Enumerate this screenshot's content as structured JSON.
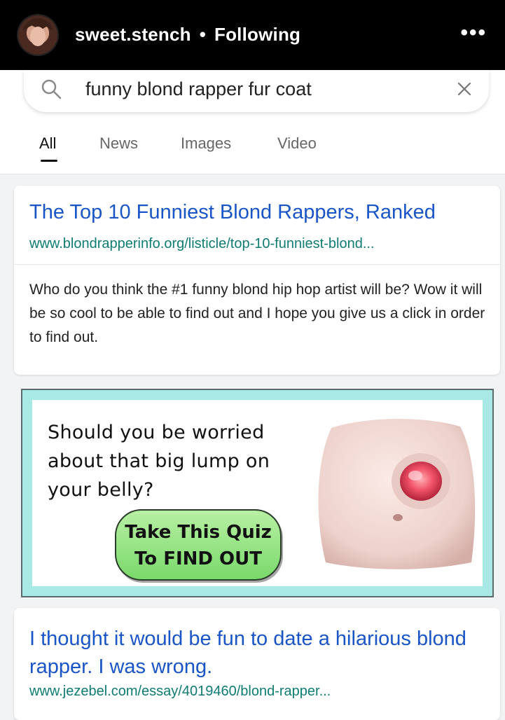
{
  "header": {
    "username": "sweet.stench",
    "separator": "•",
    "follow_status": "Following",
    "more_glyph": "•••"
  },
  "search": {
    "query": "funny blond rapper fur coat"
  },
  "tabs": [
    {
      "label": "All",
      "active": true
    },
    {
      "label": "News",
      "active": false
    },
    {
      "label": "Images",
      "active": false
    },
    {
      "label": "Video",
      "active": false
    }
  ],
  "results": [
    {
      "title": "The Top 10 Funniest Blond Rappers, Ranked",
      "url": "www.blondrapperinfo.org/listicle/top-10-funniest-blond...",
      "snippet": "Who do you think the #1 funny blond hip hop artist will be? Wow it will be so cool to be able to find out and I hope you give us a click in order to find out."
    },
    {
      "title": "I thought it would be fun to date a hilarious blond rapper. I was wrong.",
      "url": "www.jezebel.com/essay/4019460/blond-rapper..."
    }
  ],
  "ad": {
    "text": "Should you be worried about that big lump on your belly?",
    "button_line1": "Take This Quiz",
    "button_line2": "To FIND OUT"
  },
  "colors": {
    "link_blue": "#1a55c7",
    "url_green": "#0f7c72",
    "ad_border": "#a8e9e6",
    "quiz_green": "#79d96a"
  }
}
